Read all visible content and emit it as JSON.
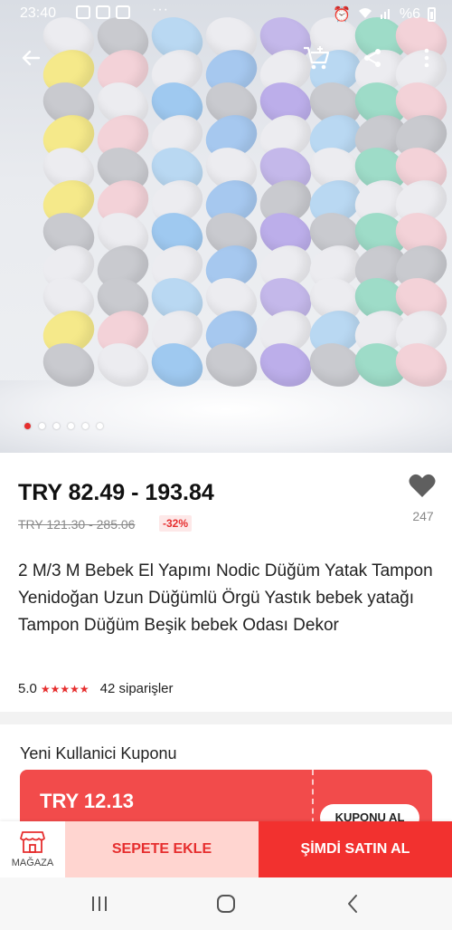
{
  "status_bar": {
    "time": "23:40",
    "dots": "···",
    "battery_text": "%6"
  },
  "top_bar": {
    "back_icon": "arrow-left-icon",
    "cart_icon": "cart-add-icon",
    "share_icon": "share-icon",
    "more_icon": "more-vert-icon"
  },
  "carousel": {
    "total": 6,
    "active_index": 0
  },
  "product": {
    "price_range": "TRY 82.49 - 193.84",
    "old_price_range": "TRY 121.30 - 285.06",
    "discount": "-32%",
    "wishlist_count": "247",
    "title": "2 M/3 M Bebek El Yapımı Nodic Düğüm Yatak Tampon Yenidoğan Uzun Düğümlü Örgü Yastık bebek yatağı Tampon Düğüm Beşik bebek Odası Dekor",
    "rating": "5.0",
    "stars": "★★★★★",
    "orders": "42 siparişler"
  },
  "coupon": {
    "heading": "Yeni Kullanici Kuponu",
    "amount": "TRY 12.13",
    "button_label": "KUPONU AL"
  },
  "action_bar": {
    "store_label": "MAĞAZA",
    "add_to_cart": "SEPETE EKLE",
    "buy_now": "ŞİMDİ SATIN AL"
  },
  "colors": {
    "accent": "#f2312f",
    "cart_bg": "#ffd5d0",
    "star": "#e62e2e"
  }
}
